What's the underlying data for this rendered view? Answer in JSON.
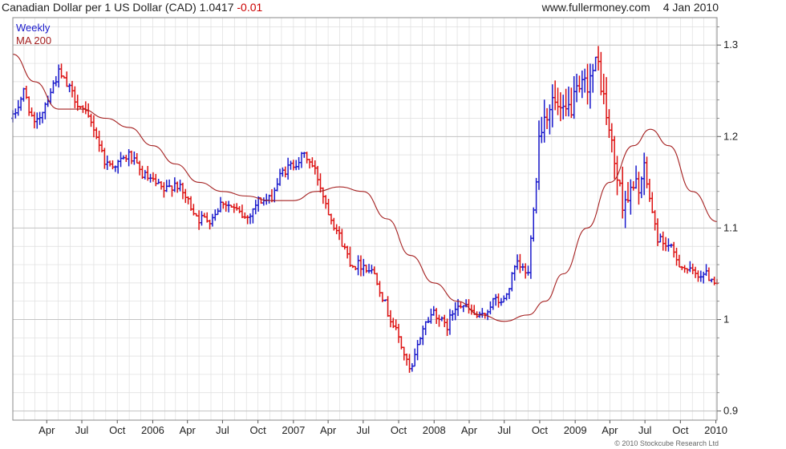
{
  "header": {
    "title": "Canadian Dollar per 1 US Dollar (CAD)",
    "last": "1.0417",
    "change": "-0.01",
    "site": "www.fullermoney.com",
    "date": "4 Jan 2010"
  },
  "copyright": "© 2010 Stockcube Research Ltd",
  "colors": {
    "up": "#1a1acc",
    "down": "#dd1111",
    "ma": "#a52020",
    "grid": "#dedede",
    "frame": "#888888"
  },
  "chart_data": {
    "type": "line",
    "series": [
      {
        "name": "Weekly",
        "style": "OHLC bars (blue up, red down)"
      },
      {
        "name": "MA 200",
        "style": "line"
      }
    ],
    "legend_position": "top-left",
    "ylim": [
      0.89,
      1.33
    ],
    "y_ticks": [
      "0.9",
      "1",
      "1.1",
      "1.2",
      "1.3"
    ],
    "y_tick_values": [
      0.9,
      1.0,
      1.1,
      1.2,
      1.3
    ],
    "x_range": [
      "2005-01-03",
      "2010-01-04"
    ],
    "x_tick_labels": [
      "Apr",
      "Jul",
      "Oct",
      "2006",
      "Apr",
      "Jul",
      "Oct",
      "2007",
      "Apr",
      "Jul",
      "Oct",
      "2008",
      "Apr",
      "Jul",
      "Oct",
      "2009",
      "Apr",
      "Jul",
      "Oct",
      "2010"
    ],
    "x_tick_dates": [
      "2005-04-01",
      "2005-07-01",
      "2005-10-01",
      "2006-01-01",
      "2006-04-01",
      "2006-07-01",
      "2006-10-01",
      "2007-01-01",
      "2007-04-01",
      "2007-07-01",
      "2007-10-01",
      "2008-01-01",
      "2008-04-01",
      "2008-07-01",
      "2008-10-01",
      "2009-01-01",
      "2009-04-01",
      "2009-07-01",
      "2009-10-01",
      "2010-01-01"
    ],
    "close_path": [
      [
        "2005-01-03",
        1.22
      ],
      [
        "2005-02-01",
        1.25
      ],
      [
        "2005-03-01",
        1.21
      ],
      [
        "2005-04-01",
        1.24
      ],
      [
        "2005-05-01",
        1.27
      ],
      [
        "2005-06-01",
        1.25
      ],
      [
        "2005-07-01",
        1.23
      ],
      [
        "2005-08-01",
        1.21
      ],
      [
        "2005-09-01",
        1.17
      ],
      [
        "2005-10-01",
        1.17
      ],
      [
        "2005-11-01",
        1.18
      ],
      [
        "2005-12-01",
        1.16
      ],
      [
        "2006-01-01",
        1.15
      ],
      [
        "2006-02-01",
        1.14
      ],
      [
        "2006-03-01",
        1.15
      ],
      [
        "2006-04-01",
        1.13
      ],
      [
        "2006-05-01",
        1.11
      ],
      [
        "2006-06-01",
        1.11
      ],
      [
        "2006-07-01",
        1.13
      ],
      [
        "2006-08-01",
        1.12
      ],
      [
        "2006-09-01",
        1.11
      ],
      [
        "2006-10-01",
        1.13
      ],
      [
        "2006-11-01",
        1.13
      ],
      [
        "2006-12-01",
        1.16
      ],
      [
        "2007-01-01",
        1.17
      ],
      [
        "2007-02-01",
        1.18
      ],
      [
        "2007-03-01",
        1.16
      ],
      [
        "2007-04-01",
        1.12
      ],
      [
        "2007-05-01",
        1.09
      ],
      [
        "2007-06-01",
        1.06
      ],
      [
        "2007-07-01",
        1.06
      ],
      [
        "2007-08-01",
        1.05
      ],
      [
        "2007-09-01",
        1.01
      ],
      [
        "2007-10-01",
        0.98
      ],
      [
        "2007-11-01",
        0.94
      ],
      [
        "2007-12-01",
        0.99
      ],
      [
        "2008-01-01",
        1.01
      ],
      [
        "2008-02-01",
        0.99
      ],
      [
        "2008-03-01",
        1.02
      ],
      [
        "2008-04-01",
        1.01
      ],
      [
        "2008-05-01",
        1.0
      ],
      [
        "2008-06-01",
        1.02
      ],
      [
        "2008-07-01",
        1.02
      ],
      [
        "2008-08-01",
        1.06
      ],
      [
        "2008-09-01",
        1.05
      ],
      [
        "2008-10-01",
        1.21
      ],
      [
        "2008-11-01",
        1.24
      ],
      [
        "2008-12-01",
        1.22
      ],
      [
        "2009-01-01",
        1.24
      ],
      [
        "2009-02-01",
        1.26
      ],
      [
        "2009-03-01",
        1.28
      ],
      [
        "2009-04-01",
        1.2
      ],
      [
        "2009-05-01",
        1.13
      ],
      [
        "2009-06-01",
        1.14
      ],
      [
        "2009-07-01",
        1.16
      ],
      [
        "2009-08-01",
        1.09
      ],
      [
        "2009-09-01",
        1.08
      ],
      [
        "2009-10-01",
        1.06
      ],
      [
        "2009-11-01",
        1.05
      ],
      [
        "2009-12-01",
        1.05
      ],
      [
        "2010-01-04",
        1.0417
      ]
    ],
    "ma_points": [
      [
        "2005-01-03",
        1.29
      ],
      [
        "2005-03-01",
        1.26
      ],
      [
        "2005-05-01",
        1.23
      ],
      [
        "2005-07-01",
        1.23
      ],
      [
        "2005-09-01",
        1.22
      ],
      [
        "2005-11-01",
        1.21
      ],
      [
        "2006-01-01",
        1.19
      ],
      [
        "2006-03-01",
        1.17
      ],
      [
        "2006-05-01",
        1.15
      ],
      [
        "2006-07-01",
        1.14
      ],
      [
        "2006-09-01",
        1.135
      ],
      [
        "2006-11-01",
        1.13
      ],
      [
        "2007-01-01",
        1.13
      ],
      [
        "2007-03-01",
        1.14
      ],
      [
        "2007-05-01",
        1.145
      ],
      [
        "2007-07-01",
        1.14
      ],
      [
        "2007-09-01",
        1.11
      ],
      [
        "2007-11-01",
        1.07
      ],
      [
        "2008-01-01",
        1.04
      ],
      [
        "2008-03-01",
        1.02
      ],
      [
        "2008-05-01",
        1.005
      ],
      [
        "2008-07-01",
        0.998
      ],
      [
        "2008-09-01",
        1.005
      ],
      [
        "2008-10-15",
        1.02
      ],
      [
        "2008-12-01",
        1.05
      ],
      [
        "2009-02-01",
        1.1
      ],
      [
        "2009-04-01",
        1.15
      ],
      [
        "2009-06-01",
        1.19
      ],
      [
        "2009-07-15",
        1.208
      ],
      [
        "2009-09-01",
        1.19
      ],
      [
        "2009-11-01",
        1.14
      ],
      [
        "2010-01-04",
        1.107
      ]
    ]
  }
}
